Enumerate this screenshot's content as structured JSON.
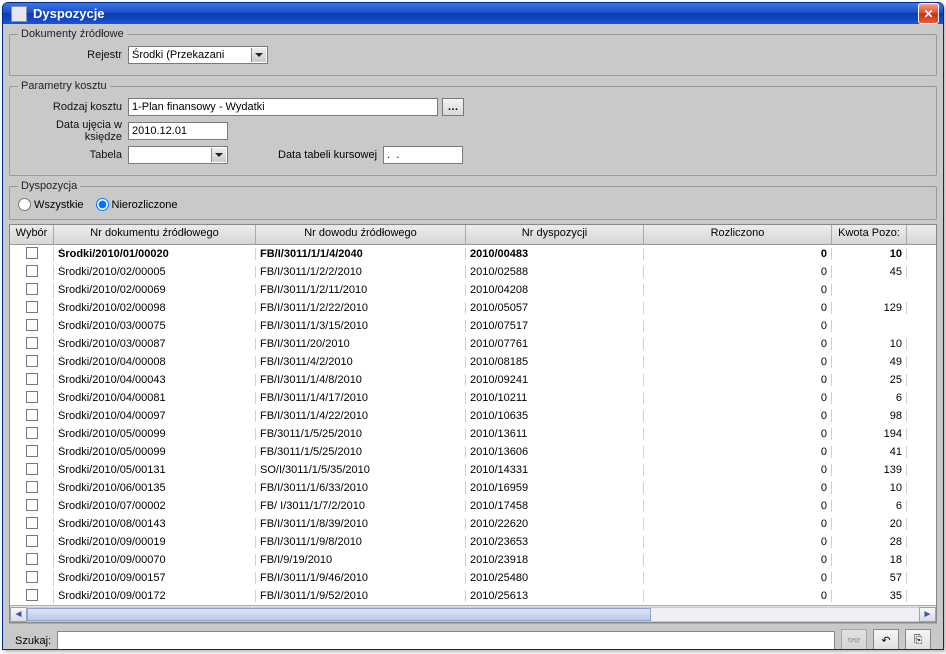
{
  "window": {
    "title": "Dyspozycje"
  },
  "section_source": {
    "legend": "Dokumenty źródłowe",
    "rejestr_label": "Rejestr",
    "rejestr_value": "Środki (Przekazani"
  },
  "section_cost": {
    "legend": "Parametry kosztu",
    "rodzaj_label": "Rodzaj kosztu",
    "rodzaj_value": "1-Plan finansowy - Wydatki",
    "data_ujecia_label": "Data ujęcia w księdze",
    "data_ujecia_value": "2010.12.01",
    "tabela_label": "Tabela",
    "tabela_value": "",
    "data_tabeli_label": "Data tabeli kursowej",
    "data_tabeli_value": ".  ."
  },
  "section_dysp": {
    "legend": "Dyspozycja",
    "opt_all": "Wszystkie",
    "opt_unsettled": "Nierozliczone"
  },
  "grid": {
    "headers": {
      "wybor": "Wybór",
      "nr_dok": "Nr dokumentu źródłowego",
      "nr_dowodu": "Nr dowodu źródłowego",
      "nr_dysp": "Nr dyspozycji",
      "rozliczono": "Rozliczono",
      "kwota": "Kwota Pozo:"
    },
    "rows": [
      {
        "bold": true,
        "dok": "Środki/2010/01/00020",
        "dowod": "FB/I/3011/1/1/4/2040",
        "dysp": "2010/00483",
        "rozl": "0",
        "kwota": "10"
      },
      {
        "dok": "Środki/2010/02/00005",
        "dowod": "FB/I/3011/1/2/2/2010",
        "dysp": "2010/02588",
        "rozl": "0",
        "kwota": "45"
      },
      {
        "dok": "Środki/2010/02/00069",
        "dowod": "FB/I/3011/1/2/11/2010",
        "dysp": "2010/04208",
        "rozl": "0",
        "kwota": ""
      },
      {
        "dok": "Środki/2010/02/00098",
        "dowod": "FB/I/3011/1/2/22/2010",
        "dysp": "2010/05057",
        "rozl": "0",
        "kwota": "129"
      },
      {
        "dok": "Środki/2010/03/00075",
        "dowod": "FB/I/3011/1/3/15/2010",
        "dysp": "2010/07517",
        "rozl": "0",
        "kwota": ""
      },
      {
        "dok": "Środki/2010/03/00087",
        "dowod": "FB/I/3011/20/2010",
        "dysp": "2010/07761",
        "rozl": "0",
        "kwota": "10"
      },
      {
        "dok": "Środki/2010/04/00008",
        "dowod": "FB/I/3011/4/2/2010",
        "dysp": "2010/08185",
        "rozl": "0",
        "kwota": "49"
      },
      {
        "dok": "Środki/2010/04/00043",
        "dowod": "FB/I/3011/1/4/8/2010",
        "dysp": "2010/09241",
        "rozl": "0",
        "kwota": "25"
      },
      {
        "dok": "Środki/2010/04/00081",
        "dowod": "FB/I/3011/1/4/17/2010",
        "dysp": "2010/10211",
        "rozl": "0",
        "kwota": "6"
      },
      {
        "dok": "Środki/2010/04/00097",
        "dowod": "FB/I/3011/1/4/22/2010",
        "dysp": "2010/10635",
        "rozl": "0",
        "kwota": "98"
      },
      {
        "dok": "Środki/2010/05/00099",
        "dowod": "FB/3011/1/5/25/2010",
        "dysp": "2010/13611",
        "rozl": "0",
        "kwota": "194"
      },
      {
        "dok": "Środki/2010/05/00099",
        "dowod": "FB/3011/1/5/25/2010",
        "dysp": "2010/13606",
        "rozl": "0",
        "kwota": "41"
      },
      {
        "dok": "Środki/2010/05/00131",
        "dowod": "SO/I/3011/1/5/35/2010",
        "dysp": "2010/14331",
        "rozl": "0",
        "kwota": "139"
      },
      {
        "dok": "Środki/2010/06/00135",
        "dowod": "FB/I/3011/1/6/33/2010",
        "dysp": "2010/16959",
        "rozl": "0",
        "kwota": "10"
      },
      {
        "dok": "Środki/2010/07/00002",
        "dowod": "FB/ I/3011/1/7/2/2010",
        "dysp": "2010/17458",
        "rozl": "0",
        "kwota": "6"
      },
      {
        "dok": "Środki/2010/08/00143",
        "dowod": "FB/I/3011/1/8/39/2010",
        "dysp": "2010/22620",
        "rozl": "0",
        "kwota": "20"
      },
      {
        "dok": "Środki/2010/09/00019",
        "dowod": "FB/I/3011/1/9/8/2010",
        "dysp": "2010/23653",
        "rozl": "0",
        "kwota": "28"
      },
      {
        "dok": "Środki/2010/09/00070",
        "dowod": "FB/I/9/19/2010",
        "dysp": "2010/23918",
        "rozl": "0",
        "kwota": "18"
      },
      {
        "dok": "Środki/2010/09/00157",
        "dowod": "FB/I/3011/1/9/46/2010",
        "dysp": "2010/25480",
        "rozl": "0",
        "kwota": "57"
      },
      {
        "dok": "Środki/2010/09/00172",
        "dowod": "FB/I/3011/1/9/52/2010",
        "dysp": "2010/25613",
        "rozl": "0",
        "kwota": "35"
      }
    ]
  },
  "footer": {
    "search_label": "Szukaj:"
  }
}
